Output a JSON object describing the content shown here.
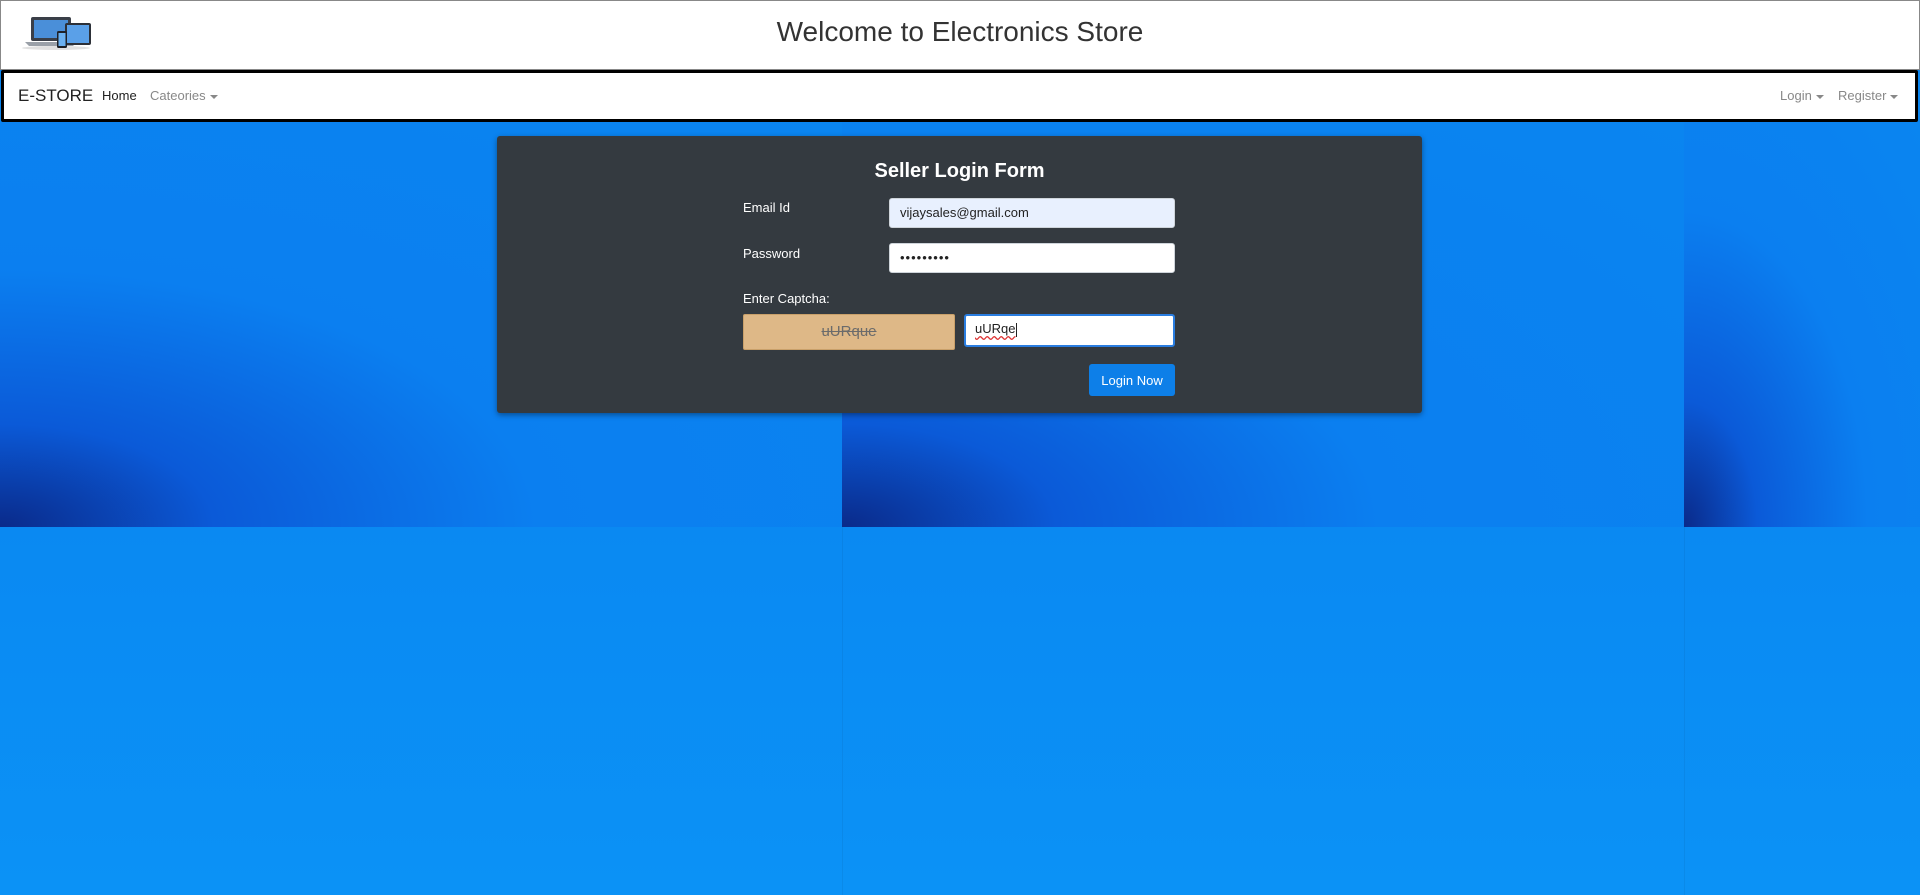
{
  "header": {
    "title": "Welcome to Electronics Store",
    "logo_icon": "devices-logo-icon"
  },
  "navbar": {
    "brand": "E-STORE",
    "items": [
      {
        "label": "Home",
        "active": true
      },
      {
        "label": "Cateories",
        "dropdown": true
      }
    ],
    "right_items": [
      {
        "label": "Login",
        "dropdown": true
      },
      {
        "label": "Register",
        "dropdown": true
      }
    ]
  },
  "form": {
    "title": "Seller Login Form",
    "email_label": "Email Id",
    "email_value": "vijaysales@gmail.com",
    "password_label": "Password",
    "password_value": "•••••••••",
    "captcha_label": "Enter Captcha:",
    "captcha_code": "uURque",
    "captcha_input_value": "uURqe",
    "submit_label": "Login Now"
  },
  "colors": {
    "background": "#0a85f0",
    "card": "#343a40",
    "captcha_bg": "#deb887",
    "button": "#0d7fe8"
  }
}
